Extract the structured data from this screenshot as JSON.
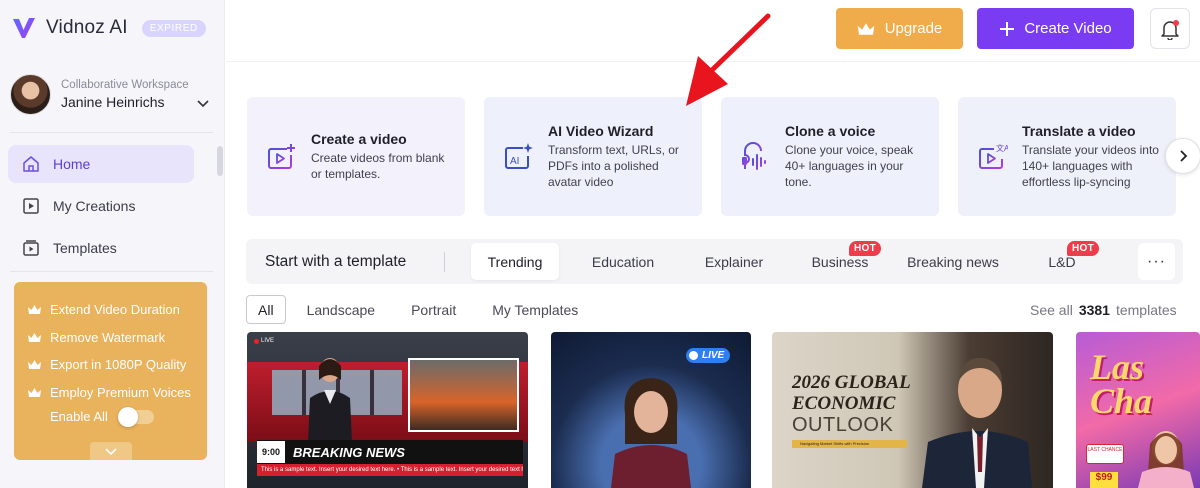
{
  "brand": {
    "name": "Vidnoz AI",
    "badge": "EXPIRED"
  },
  "workspace": {
    "label": "Collaborative Workspace",
    "name": "Janine Heinrichs"
  },
  "nav": [
    {
      "label": "Home",
      "icon": "home-icon",
      "active": true
    },
    {
      "label": "My Creations",
      "icon": "play-square-icon",
      "active": false
    },
    {
      "label": "Templates",
      "icon": "template-icon",
      "active": false
    }
  ],
  "promo": {
    "items": [
      "Extend Video Duration",
      "Remove Watermark",
      "Export in 1080P Quality",
      "Employ Premium Voices"
    ],
    "toggle_label": "Enable All",
    "toggle_on": false
  },
  "topbar": {
    "upgrade_label": "Upgrade",
    "create_label": "Create Video",
    "icons": {
      "upgrade": "crown-icon",
      "create": "plus-icon",
      "notifications": "bell-icon"
    }
  },
  "feature_cards": [
    {
      "title": "Create a video",
      "desc": "Create videos from blank or templates.",
      "icon": "video-plus-icon"
    },
    {
      "title": "AI Video Wizard",
      "desc": "Transform text, URLs, or PDFs into a polished avatar video",
      "icon": "ai-sparkle-icon"
    },
    {
      "title": "Clone a voice",
      "desc": "Clone your voice, speak 40+ languages in your tone.",
      "icon": "voice-clone-icon"
    },
    {
      "title": "Translate a video",
      "desc": "Translate your videos into 140+ languages with effortless lip-syncing",
      "icon": "translate-video-icon"
    }
  ],
  "templates": {
    "heading": "Start with a template",
    "tabs": [
      {
        "label": "Trending",
        "active": true,
        "hot": false
      },
      {
        "label": "Education",
        "active": false,
        "hot": false
      },
      {
        "label": "Explainer",
        "active": false,
        "hot": false
      },
      {
        "label": "Business",
        "active": false,
        "hot": true
      },
      {
        "label": "Breaking news",
        "active": false,
        "hot": false
      },
      {
        "label": "L&D",
        "active": false,
        "hot": true
      }
    ],
    "hot_label": "HOT",
    "more_label": "···",
    "filters": [
      {
        "label": "All",
        "active": true
      },
      {
        "label": "Landscape",
        "active": false
      },
      {
        "label": "Portrait",
        "active": false
      },
      {
        "label": "My Templates",
        "active": false
      }
    ],
    "see_all": {
      "prefix": "See all",
      "count": "3381",
      "suffix": "templates"
    }
  },
  "thumbnails": {
    "t1": {
      "live": "LIVE",
      "time": "9:00",
      "headline": "BREAKING NEWS",
      "ticker": "This is a sample text. Insert your desired text here. • This is a sample text. Insert your desired text here. • This is a sample text. Insert your desired text here."
    },
    "t2": {
      "live": "LIVE"
    },
    "t3": {
      "title_line1": "2026 GLOBAL",
      "title_line2": "ECONOMIC",
      "subtitle": "OUTLOOK",
      "tagline": "Navigating Market Shifts with Precision"
    },
    "t4": {
      "title_line1": "Las",
      "title_line2": "Cha",
      "tag": "LAST CHANCE",
      "price": "$99"
    }
  },
  "colors": {
    "accent": "#7a3cf3",
    "upgrade": "#f0ac4a",
    "promo": "#e9b25c",
    "hot": "#ef3b4a",
    "annotation_arrow": "#e8141e"
  }
}
